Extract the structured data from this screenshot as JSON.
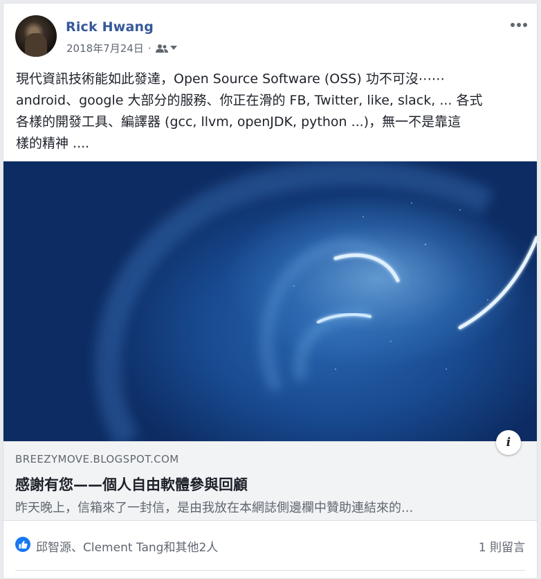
{
  "post": {
    "author": "Rick Hwang",
    "date": "2018年7月24日",
    "separator": "·",
    "text_lines": [
      "現代資訊技術能如此發達，Open Source Software (OSS) 功不可沒⋯⋯",
      "android、google 大部分的服務、你正在滑的 FB, Twitter, like, slack, ... 各式",
      "各樣的開發工具、編譯器 (gcc, llvm, openJDK, python ...)，無一不是靠這",
      "樣的精神 ...."
    ]
  },
  "link_preview": {
    "domain": "BREEZYMOVE.BLOGSPOT.COM",
    "title": "感謝有您——個人自由軟體參與回顧",
    "description": "昨天晚上，信箱來了一封信，是由我放在本網誌側邊欄中贊助連結來的...",
    "info_label": "i"
  },
  "footer": {
    "reactors": "邱智源、Clement Tang和其他2人",
    "comments": "1 則留言"
  },
  "icons": {
    "audience": "friends-icon",
    "more": "more-dots-icon",
    "like": "thumbs-up-icon"
  },
  "colors": {
    "author": "#365899",
    "like_badge": "#1877f2",
    "caption_bg": "#f2f3f5"
  }
}
